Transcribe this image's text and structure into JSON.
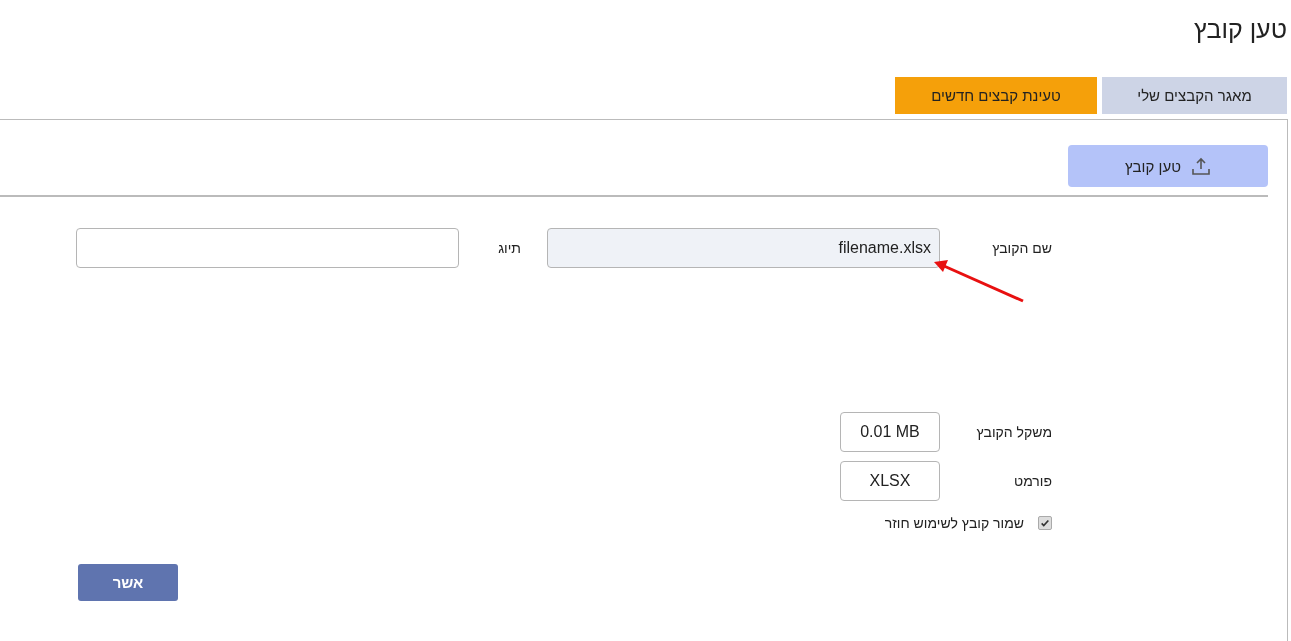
{
  "page_title": "טען קובץ",
  "tabs": [
    {
      "label": "מאגר הקבצים שלי",
      "selected": false
    },
    {
      "label": "טעינת קבצים חדשים",
      "selected": true
    }
  ],
  "upload_button": {
    "label": "טען קובץ"
  },
  "file_name": {
    "label": "שם הקובץ",
    "value": "filename.xlsx"
  },
  "tag": {
    "label": "תיוג"
  },
  "file_size": {
    "label": "משקל הקובץ",
    "value": "0.01 MB"
  },
  "format": {
    "label": "פורמט",
    "value": "XLSX"
  },
  "save_for_reuse": {
    "label": "שמור קובץ לשימוש חוזר",
    "checked": true
  },
  "confirm_button": {
    "label": "אשר"
  }
}
